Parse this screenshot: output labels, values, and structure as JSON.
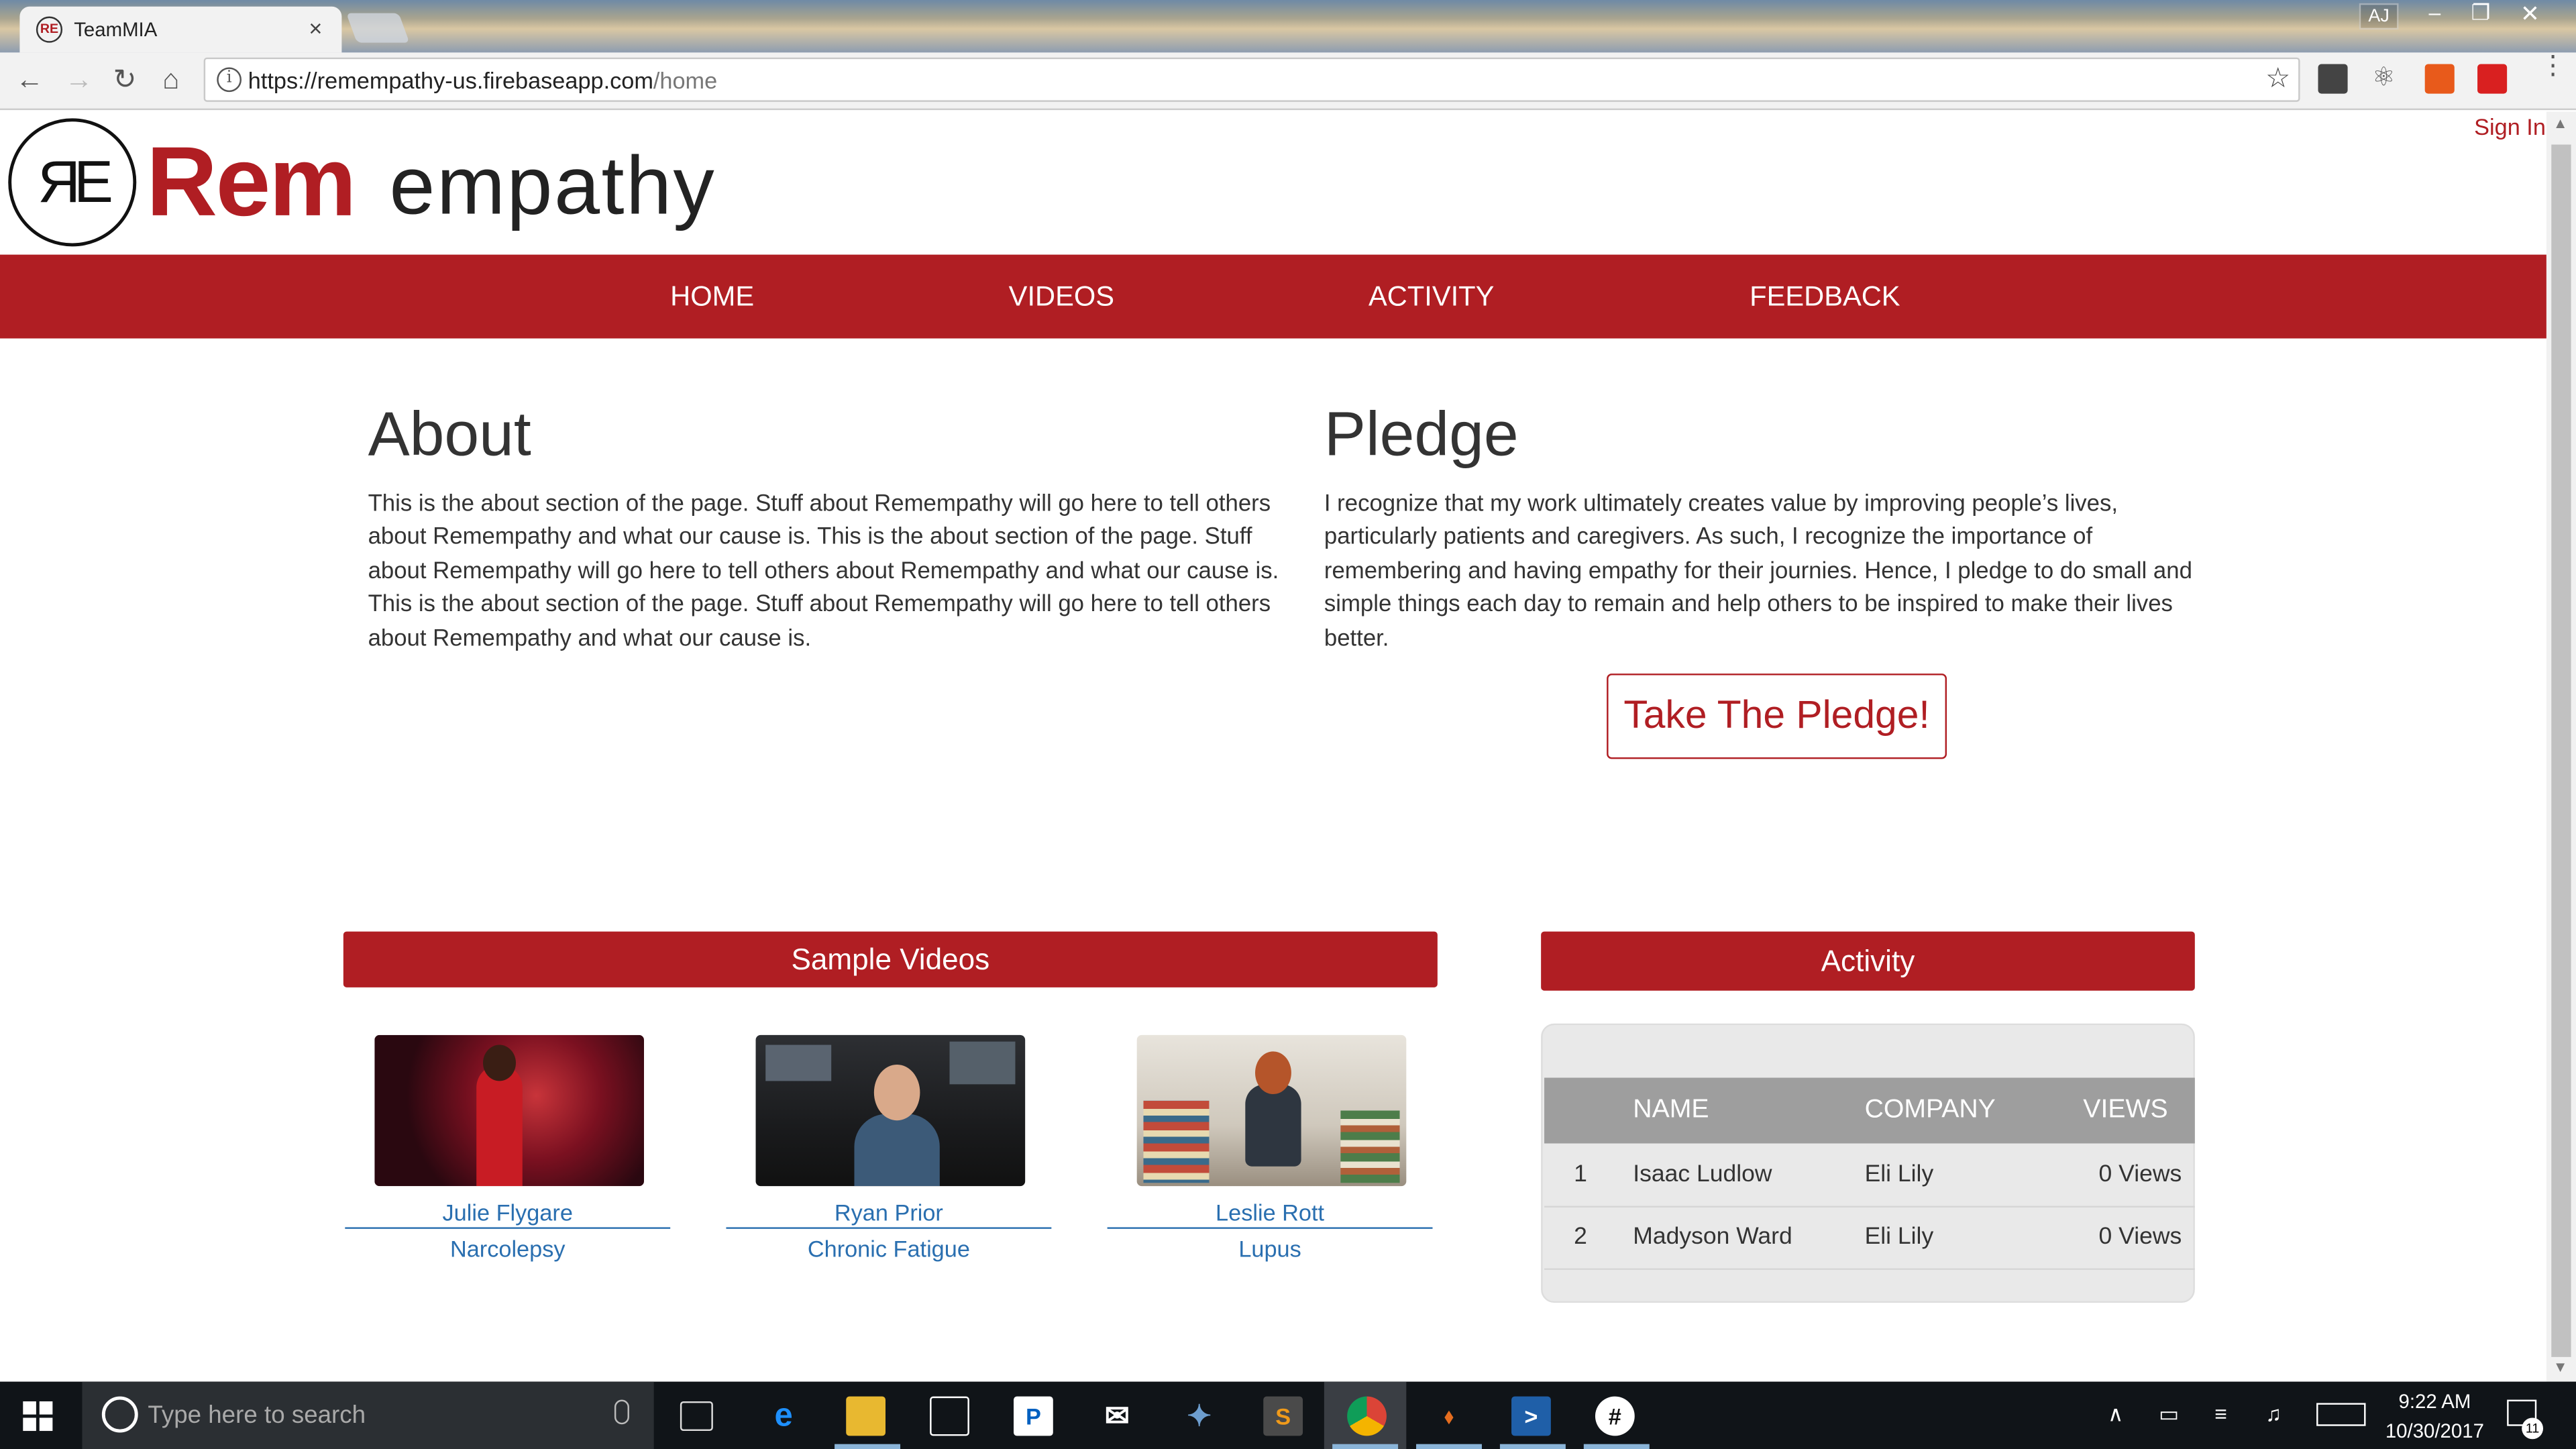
{
  "browser": {
    "tab_title": "TeamMIA",
    "tab_favicon": "RE",
    "tab_close": "×",
    "profile": "AJ",
    "url_host": "https://remempathy-us.firebaseapp.com",
    "url_path": "/home",
    "icons": [
      "back-icon",
      "forward-icon",
      "reload-icon",
      "home-icon",
      "info-icon",
      "star-icon",
      "menu-icon"
    ]
  },
  "page": {
    "sign_in": "Sign In",
    "logo": {
      "mark": "ЯE",
      "rem": "Rem",
      "empathy": "empathy"
    },
    "nav": [
      "HOME",
      "VIDEOS",
      "ACTIVITY",
      "FEEDBACK"
    ],
    "about": {
      "title": "About",
      "text": "This is the about section of the page. Stuff about Remempathy will go here to tell others about Remempathy and what our cause is. This is the about section of the page. Stuff about Remempathy will go here to tell others about Remempathy and what our cause is. This is the about section of the page. Stuff about Remempathy will go here to tell others about Remempathy and what our cause is."
    },
    "pledge": {
      "title": "Pledge",
      "text": "I recognize that my work ultimately creates value by improving people’s lives, particularly patients and caregivers. As such, I recognize the importance of remembering and having empathy for their journies. Hence, I pledge to do small and simple things each day to remain and help others to be inspired to make their lives better.",
      "button": "Take The Pledge!"
    },
    "videos": {
      "header": "Sample Videos",
      "items": [
        {
          "name": "Julie Flygare",
          "condition": "Narcolepsy"
        },
        {
          "name": "Ryan Prior",
          "condition": "Chronic Fatigue"
        },
        {
          "name": "Leslie Rott",
          "condition": "Lupus"
        }
      ]
    },
    "activity": {
      "header": "Activity",
      "columns": [
        "NAME",
        "COMPANY",
        "VIEWS"
      ],
      "rows": [
        {
          "rank": "1",
          "name": "Isaac Ludlow",
          "company": "Eli Lily",
          "views": "0 Views"
        },
        {
          "rank": "2",
          "name": "Madyson Ward",
          "company": "Eli Lily",
          "views": "0 Views"
        }
      ]
    }
  },
  "taskbar": {
    "search_placeholder": "Type here to search",
    "time": "9:22 AM",
    "date": "10/30/2017",
    "notifications": "11",
    "accent": "#b01e23"
  }
}
